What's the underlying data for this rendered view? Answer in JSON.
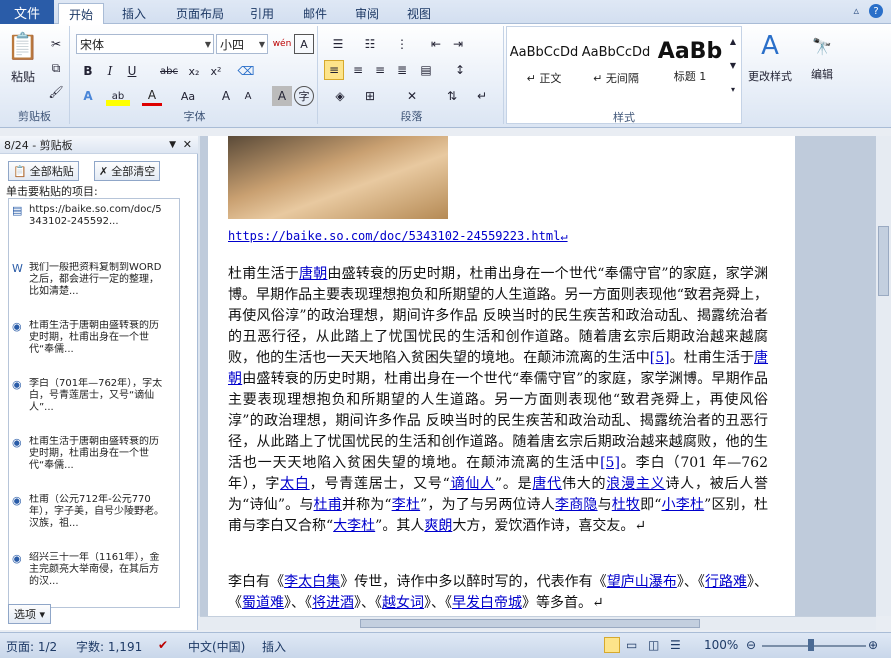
{
  "tabs": {
    "file": "文件",
    "home": "开始",
    "insert": "插入",
    "layout": "页面布局",
    "references": "引用",
    "mailings": "邮件",
    "review": "审阅",
    "view": "视图"
  },
  "ribbon": {
    "clipboard": {
      "group": "剪贴板",
      "paste": "粘贴"
    },
    "font": {
      "group": "字体",
      "family": "宋体",
      "size": "小四",
      "wen": "wén",
      "bold": "B",
      "italic": "I",
      "underline": "U",
      "strike": "abc",
      "sub": "x₂",
      "sup": "x²",
      "a": "A",
      "aa": "Aa",
      "grow": "A",
      "shrink": "A",
      "yu": "字"
    },
    "paragraph": {
      "group": "段落"
    },
    "styles": {
      "group": "样式",
      "items": [
        {
          "sample": "AaBbCcDd",
          "name": "↵ 正文"
        },
        {
          "sample": "AaBbCcDd",
          "name": "↵ 无间隔"
        },
        {
          "sample": "AaBb",
          "name": "标题 1"
        }
      ],
      "change": "更改样式"
    },
    "editing": {
      "label": "编辑"
    }
  },
  "pane": {
    "title": "8/24 - 剪贴板",
    "paste_all": "全部粘贴",
    "clear_all": "全部清空",
    "hint": "单击要粘贴的项目:",
    "items": [
      "https://baike.so.com/doc/5343102-245592...",
      "我们一般把资料复制到WORD之后，都会进行一定的整理，比如清楚...",
      "杜甫生活于唐朝由盛转衰的历史时期，杜甫出身在一个世代“奉儒...",
      "李白（701年—762年），字太白，号青莲居士，又号“谪仙人”...",
      "杜甫生活于唐朝由盛转衰的历史时期，杜甫出身在一个世代“奉儒...",
      "杜甫（公元712年-公元770年），字子美，自号少陵野老。汉族，祖...",
      "绍兴三十一年（1161年），金主完颜亮大举南侵，在其后方的汉..."
    ],
    "options": "选项 ▾"
  },
  "doc": {
    "url": "https://baike.so.com/doc/5343102-24559223.html↵",
    "p1_a": "杜甫生活于",
    "tangchao": "唐朝",
    "p1_b": "由盛转衰的历史时期，杜甫出身在一个世代“奉儒守官”的家庭，家学渊博。早期作品主要表现理想抱负和所期望的人生道路。另一方面则表现他“致君尧舜上，再使风俗淳”的政治理想，期间许多作品 反映当时的民生疾苦和政治动乱、揭露统治者的丑恶行径，从此踏上了忧国忧民的生活和创作道路。随着唐玄宗后期政治越来越腐败，他的生活也一天天地陷入贫困失望的境地。在颠沛流离的生活中",
    "ref5": "[5]",
    "p1_c": "。杜甫生活于",
    "p1_d": "由盛转衰的历史时期，杜甫出身在一个世代“奉儒守官”的家庭，家学渊博。早期作品主要表现理想抱负和所期望的人生道路。另一方面则表现他“致君尧舜上，再使风俗淳”的政治理想，期间许多作品 反映当时的民生疾苦和政治动乱、揭露统治者的丑恶行径，从此踏上了忧国忧民的生活和创作道路。随着唐玄宗后期政治越来越腐败，他的生活也一天天地陷入贫困失望的境地。在颠沛流离的生活中",
    "p1_e": "。李白（701 年—762 年），字",
    "taibai": "太白",
    "p1_f": "，号青莲居士，又号“",
    "zhexian": "谪仙人",
    "p1_g": "”。是",
    "tangdai": "唐代",
    "p1_h": "伟大的",
    "langman": "浪漫主义",
    "p1_i": "诗人，被后人誉为“诗仙”。与",
    "dufu": "杜甫",
    "p1_j": "并称为“",
    "lidu": "李杜",
    "p1_k": "”，为了与另两位诗人",
    "lishangyin": "李商隐",
    "p1_l": "与",
    "dumu": "杜牧",
    "p1_m": "即“",
    "xiaolidu": "小李杜",
    "p1_n": "”区别，杜甫与李白又合称“",
    "dalidu": "大李杜",
    "p1_o": "”。其人",
    "shuanglang": "爽朗",
    "p1_p": "大方，爱饮酒作诗，喜交友。↵",
    "p2_a": "李白有《",
    "libaiji": "李太白集",
    "p2_b": "》传世，诗作中多以醉时写的，代表作有《",
    "wanglu": "望庐山瀑布",
    "p2_c": "》、《",
    "xinglu": "行路难",
    "p2_d": "》、《",
    "shudao": "蜀道难",
    "p2_e": "》、《",
    "jiangjin": "将进酒",
    "p2_f": "》、《",
    "yuenv": "越女词",
    "p2_g": "》、《",
    "zaofa": "早发白帝城",
    "p2_h": "》等多首。↵"
  },
  "status": {
    "page": "页面: 1/2",
    "words": "字数: 1,191",
    "lang": "中文(中国)",
    "mode": "插入",
    "zoom": "100%"
  }
}
